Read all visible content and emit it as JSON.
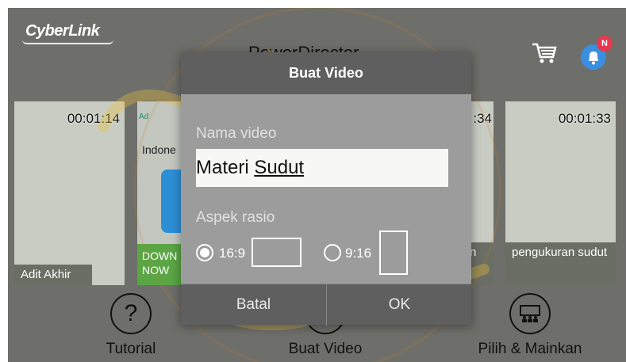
{
  "header": {
    "logo_text": "CyberLink",
    "app_title": "PowerDirector",
    "cart_icon": "shopping-cart-icon",
    "bell_icon": "notification-bell-icon",
    "notification_badge": "N"
  },
  "projects": [
    {
      "duration": "00:01:14",
      "name": "Adit Akhir"
    },
    {
      "duration": ":34",
      "name": "n"
    },
    {
      "duration": "00:01:33",
      "name": "pengukuran sudut"
    }
  ],
  "ad": {
    "tag": "Ad",
    "text_line1": "D",
    "text_line2": "Indone",
    "cta": "DOWN NOW"
  },
  "actions": [
    {
      "label": "Tutorial",
      "icon": "question-icon"
    },
    {
      "label": "Buat Video",
      "icon": "create-video-icon"
    },
    {
      "label": "Pilih & Mainkan",
      "icon": "presentation-audience-icon"
    }
  ],
  "dialog": {
    "title": "Buat Video",
    "name_label": "Nama video",
    "name_value_part1": "Materi ",
    "name_value_part2": "Sudut",
    "aspect_label": "Aspek rasio",
    "ratio_16_9": "16:9",
    "ratio_9_16": "9:16",
    "selected_ratio": "16:9",
    "cancel": "Batal",
    "ok": "OK"
  },
  "colors": {
    "dialog_bg": "#5f5f5f",
    "dialog_body": "#9c9c9c",
    "badge": "#e8384f",
    "bell": "#3a8fe0",
    "watermark": "#e8c13a"
  }
}
